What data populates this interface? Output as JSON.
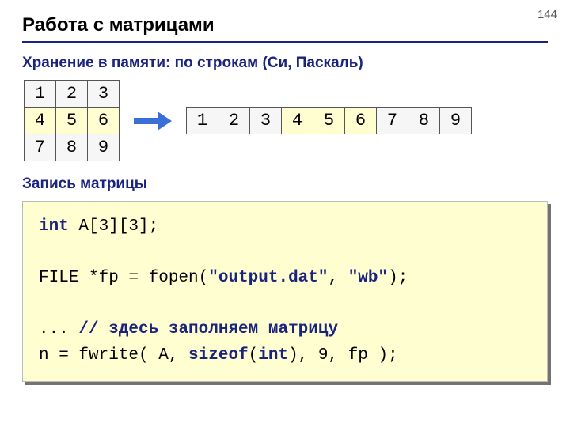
{
  "page_number": "144",
  "title": "Работа с матрицами",
  "subhead_storage": "Хранение в памяти: по строкам (Си, Паскаль)",
  "subhead_write": "Запись матрицы",
  "matrix": {
    "r0": {
      "c0": "1",
      "c1": "2",
      "c2": "3"
    },
    "r1": {
      "c0": "4",
      "c1": "5",
      "c2": "6"
    },
    "r2": {
      "c0": "7",
      "c1": "8",
      "c2": "9"
    }
  },
  "linear": {
    "c0": "1",
    "c1": "2",
    "c2": "3",
    "c3": "4",
    "c4": "5",
    "c5": "6",
    "c6": "7",
    "c7": "8",
    "c8": "9"
  },
  "code": {
    "kw_int": "int",
    "decl_rest": " A[3][3];",
    "line2a": "FILE *fp = fopen(",
    "str1": "\"output.dat\"",
    "line2b": ", ",
    "str2": "\"wb\"",
    "line2c": ");",
    "ellipsis": "... ",
    "comment": "// здесь заполняем матрицу",
    "line4a": "n = fwrite( A, ",
    "kw_sizeof": "sizeof",
    "line4b": "(",
    "kw_int2": "int",
    "line4c": "), 9, fp );"
  }
}
